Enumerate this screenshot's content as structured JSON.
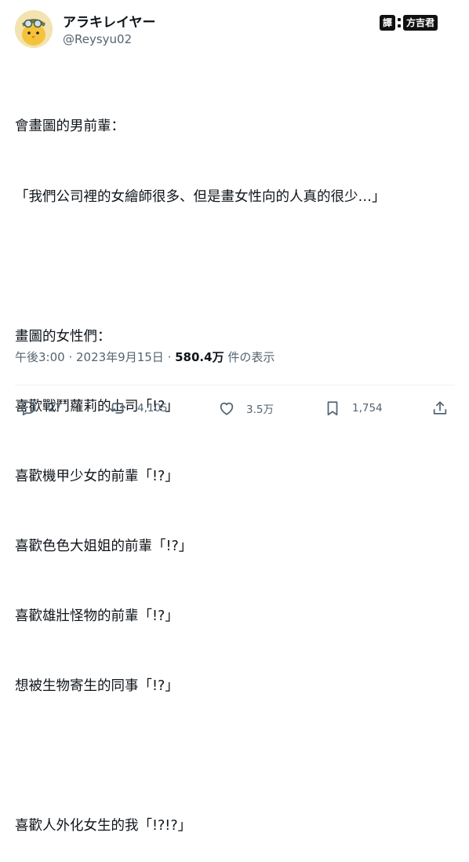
{
  "user": {
    "display_name": "アラキレイヤー",
    "handle": "@Reysyu02",
    "avatar_icon": "chick-avatar-icon"
  },
  "translator_badge": {
    "left": "譯",
    "right": "方吉君"
  },
  "tweet": {
    "lines": [
      "會畫圖的男前輩：",
      "「我們公司裡的女繪師很多、但是畫女性向的人真的很少…」",
      "",
      "畫圖的女性們：",
      "喜歡戰鬥蘿莉的上司「!?」",
      "喜歡機甲少女的前輩「!?」",
      "喜歡色色大姐姐的前輩「!?」",
      "喜歡雄壯怪物的前輩「!?」",
      "想被生物寄生的同事「!?」",
      "",
      "喜歡人外化女生的我「!?!?」"
    ]
  },
  "meta": {
    "time": "午後3:00",
    "separator": " · ",
    "date": "2023年9月15日",
    "separator2": " · ",
    "views_count": "580.4万",
    "views_label": " 件の表示"
  },
  "actions": {
    "reply": {
      "icon": "reply-icon",
      "count": "27"
    },
    "retweet": {
      "icon": "retweet-icon",
      "count": "4,105"
    },
    "like": {
      "icon": "heart-icon",
      "count": "3.5万"
    },
    "bookmark": {
      "icon": "bookmark-icon",
      "count": "1,754"
    },
    "share": {
      "icon": "share-icon"
    }
  },
  "colors": {
    "text": "#0f1419",
    "secondary": "#536471",
    "divider": "#eff3f4"
  }
}
